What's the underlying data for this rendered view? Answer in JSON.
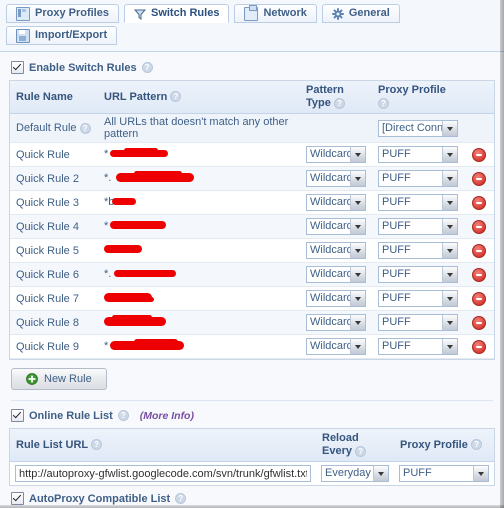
{
  "window": {
    "tabs_row1": [
      {
        "label": "Proxy Profiles",
        "icon": "proxy-profiles-icon",
        "active": false
      },
      {
        "label": "Switch Rules",
        "icon": "funnel-icon",
        "active": true
      },
      {
        "label": "Network",
        "icon": "network-icon",
        "active": false
      },
      {
        "label": "General",
        "icon": "gear-icon",
        "active": false
      }
    ],
    "tabs_row2": [
      {
        "label": "Import/Export",
        "icon": "save-icon",
        "active": false
      }
    ]
  },
  "switch_rules": {
    "enable_label": "Enable Switch Rules",
    "enable_checked": true,
    "columns": {
      "rule_name": "Rule Name",
      "url_pattern": "URL Pattern",
      "pattern_type": "Pattern Type",
      "proxy_profile": "Proxy Profile"
    },
    "default_rule": {
      "name": "Default Rule",
      "pattern": "All URLs that doesn't match any other pattern",
      "pattern_type": "",
      "proxy_profile": "[Direct Connect"
    },
    "rows": [
      {
        "name": "Quick Rule",
        "pattern": "*",
        "redacted": true,
        "pattern_type": "Wildcard",
        "proxy_profile": "PUFF"
      },
      {
        "name": "Quick Rule 2",
        "pattern": "*.",
        "redacted": true,
        "pattern_type": "Wildcard",
        "proxy_profile": "PUFF"
      },
      {
        "name": "Quick Rule 3",
        "pattern": "*b",
        "redacted": true,
        "pattern_type": "Wildcard",
        "proxy_profile": "PUFF"
      },
      {
        "name": "Quick Rule 4",
        "pattern": "*",
        "redacted": true,
        "pattern_type": "Wildcard",
        "proxy_profile": "PUFF"
      },
      {
        "name": "Quick Rule 5",
        "pattern": "",
        "redacted": true,
        "pattern_type": "Wildcard",
        "proxy_profile": "PUFF"
      },
      {
        "name": "Quick Rule 6",
        "pattern": "*.",
        "redacted": true,
        "pattern_type": "Wildcard",
        "proxy_profile": "PUFF"
      },
      {
        "name": "Quick Rule 7",
        "pattern": "",
        "redacted": true,
        "pattern_type": "Wildcard",
        "proxy_profile": "PUFF"
      },
      {
        "name": "Quick Rule 8",
        "pattern": "",
        "redacted": true,
        "pattern_type": "Wildcard",
        "proxy_profile": "PUFF"
      },
      {
        "name": "Quick Rule 9",
        "pattern": "*",
        "redacted": true,
        "pattern_type": "Wildcard",
        "proxy_profile": "PUFF"
      }
    ],
    "new_rule_label": "New Rule"
  },
  "online_rule_list": {
    "enable_label": "Online Rule List",
    "enable_checked": true,
    "more_info_label": "(More Info)",
    "columns": {
      "rule_list_url": "Rule List URL",
      "reload_every": "Reload Every",
      "proxy_profile": "Proxy Profile"
    },
    "url_value": "http://autoproxy-gfwlist.googlecode.com/svn/trunk/gfwlist.txt",
    "reload_value": "Everyday",
    "proxy_value": "PUFF",
    "autoproxy_label": "AutoProxy Compatible List",
    "autoproxy_checked": true
  },
  "colors": {
    "accent": "#3f5f86",
    "header_bg": "#e5eef8",
    "delete_red": "#d93b32",
    "redaction_red": "#ef0000",
    "more_info_purple": "#7a4fa3"
  }
}
